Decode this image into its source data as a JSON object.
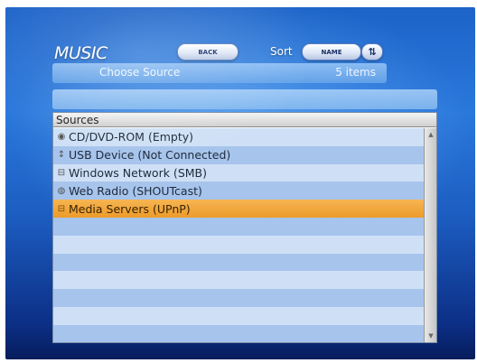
{
  "app": {
    "title": "MUSIC"
  },
  "toolbar": {
    "back_label": "BACK",
    "sort_label": "Sort",
    "sort_field": "NAME",
    "sort_direction_icon": "sort-toggle-icon"
  },
  "header": {
    "title": "Choose Source",
    "count": "5 items"
  },
  "list": {
    "column_header": "Sources",
    "items": [
      {
        "label": "CD/DVD-ROM (Empty)",
        "icon": "disc-icon"
      },
      {
        "label": "USB Device (Not Connected)",
        "icon": "usb-icon"
      },
      {
        "label": "Windows Network (SMB)",
        "icon": "network-icon"
      },
      {
        "label": "Web Radio (SHOUTcast)",
        "icon": "radio-icon"
      },
      {
        "label": "Media Servers (UPnP)",
        "icon": "server-icon",
        "selected": true
      }
    ]
  },
  "colors": {
    "selection": "#ec9b2a",
    "row_light": "#cfe0f6",
    "row_dark": "#a7c4ec",
    "background": "#1c5cc0"
  }
}
